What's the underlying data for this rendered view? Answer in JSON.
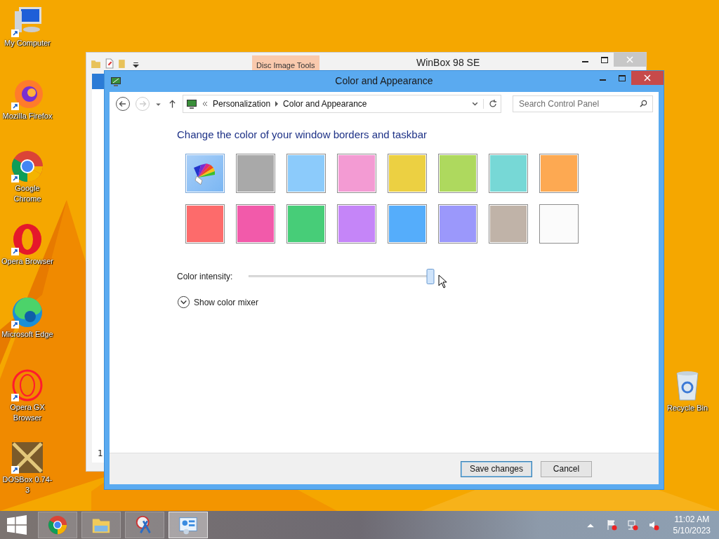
{
  "desktop_icons": [
    {
      "kind": "computer",
      "label": "My Computer"
    },
    {
      "kind": "firefox",
      "label": "Mozilla Firefox"
    },
    {
      "kind": "chrome",
      "label": "Google Chrome"
    },
    {
      "kind": "opera",
      "label": "Opera Browser"
    },
    {
      "kind": "edge",
      "label": "Microsoft Edge"
    },
    {
      "kind": "operagx",
      "label": "Opera GX Browser"
    },
    {
      "kind": "dosbox",
      "label": "DOSBox 0.74-3"
    }
  ],
  "recycle_bin": {
    "label": "Recycle Bin"
  },
  "back_window": {
    "title": "WinBox 98 SE",
    "contextual_tab": "Disc Image Tools",
    "status_fragment": "1"
  },
  "window": {
    "title": "Color and Appearance",
    "address": {
      "crumbs": [
        "Personalization",
        "Color and Appearance"
      ]
    },
    "search": {
      "placeholder": "Search Control Panel"
    },
    "heading": "Change the color of your window borders and taskbar",
    "swatches": [
      {
        "kind": "auto",
        "selected": true
      },
      {
        "kind": "color",
        "color": "#a9a9a9",
        "selected": false
      },
      {
        "kind": "color",
        "color": "#8ccbfb",
        "selected": false
      },
      {
        "kind": "color",
        "color": "#f39bd3",
        "selected": false
      },
      {
        "kind": "color",
        "color": "#ecd042",
        "selected": false
      },
      {
        "kind": "color",
        "color": "#aed95e",
        "selected": false
      },
      {
        "kind": "color",
        "color": "#77d8d6",
        "selected": false
      },
      {
        "kind": "color",
        "color": "#fda952",
        "selected": false
      },
      {
        "kind": "color",
        "color": "#fd6b6b",
        "selected": false
      },
      {
        "kind": "color",
        "color": "#f25aaa",
        "selected": false
      },
      {
        "kind": "color",
        "color": "#47cd78",
        "selected": false
      },
      {
        "kind": "color",
        "color": "#c585f8",
        "selected": false
      },
      {
        "kind": "color",
        "color": "#55adfb",
        "selected": false
      },
      {
        "kind": "color",
        "color": "#9b98fb",
        "selected": false
      },
      {
        "kind": "color",
        "color": "#c0b3a8",
        "selected": false
      },
      {
        "kind": "color",
        "color": "#fbfbfb",
        "selected": false
      }
    ],
    "intensity": {
      "label": "Color intensity:",
      "level": 0.99
    },
    "mixer": {
      "label": "Show color mixer",
      "expanded": false
    },
    "buttons": [
      {
        "label": "Save changes",
        "default": true
      },
      {
        "label": "Cancel",
        "default": false
      }
    ]
  },
  "taskbar": {
    "apps": [
      {
        "kind": "chrome",
        "selected": false
      },
      {
        "kind": "explorer",
        "selected": false
      },
      {
        "kind": "tool",
        "selected": false
      },
      {
        "kind": "panel",
        "selected": true
      }
    ],
    "clock": {
      "time": "11:02 AM",
      "date": "5/10/2023"
    }
  }
}
